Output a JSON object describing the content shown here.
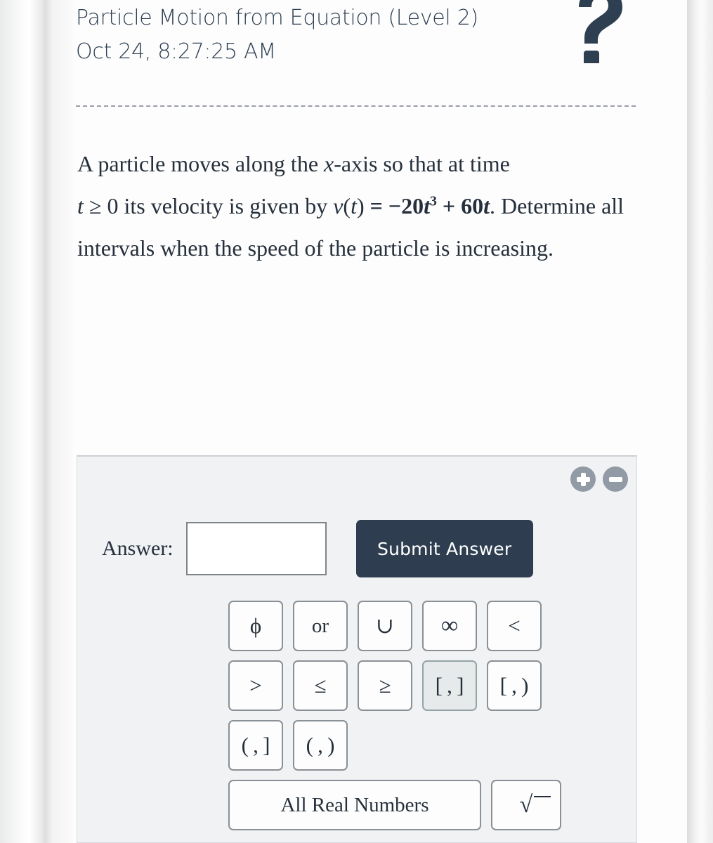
{
  "header": {
    "title": "Particle Motion from Equation (Level 2)",
    "timestamp": "Oct 24, 8:27:25 AM",
    "help_icon": "question-mark-icon"
  },
  "question": {
    "part1": "A particle moves along the ",
    "var_x": "x",
    "part2": "-axis so that at time ",
    "var_t": "t",
    "part3": " ≥ 0 its velocity is given by ",
    "equation_v": "v",
    "equation_open": "(",
    "equation_t": "t",
    "equation_close": ")",
    "equation_eq": " = −20",
    "equation_base": "t",
    "equation_exp": "3",
    "equation_plus": " + 60",
    "equation_tail": "t",
    "part4": ". Determine all intervals when the speed of the particle is increasing.",
    "full_text": "A particle moves along the x-axis so that at time t ≥ 0 its velocity is given by v(t) = −20t³ + 60t. Determine all intervals when the speed of the particle is increasing."
  },
  "answer_panel": {
    "label": "Answer:",
    "input_value": "",
    "input_placeholder": "",
    "submit_label": "Submit Answer",
    "zoom_in_label": "+",
    "zoom_out_label": "−",
    "zoom_in_icon": "plus-circle-icon",
    "zoom_out_icon": "minus-circle-icon"
  },
  "keypad": {
    "rows": [
      [
        {
          "label": "ϕ",
          "name": "empty-set",
          "selected": false
        },
        {
          "label": "or",
          "name": "or",
          "selected": false
        },
        {
          "label": "∪",
          "name": "union",
          "selected": false
        },
        {
          "label": "∞",
          "name": "infinity",
          "selected": false
        },
        {
          "label": "<",
          "name": "less-than",
          "selected": false
        }
      ],
      [
        {
          "label": ">",
          "name": "greater-than",
          "selected": false
        },
        {
          "label": "≤",
          "name": "less-than-or-equal",
          "selected": false
        },
        {
          "label": "≥",
          "name": "greater-than-or-equal",
          "selected": false
        },
        {
          "label": "[ , ]",
          "name": "closed-interval",
          "selected": true
        },
        {
          "label": "[ , )",
          "name": "half-open-interval-right",
          "selected": false
        }
      ],
      [
        {
          "label": "( , ]",
          "name": "half-open-interval-left",
          "selected": false
        },
        {
          "label": "( , )",
          "name": "open-interval",
          "selected": false
        }
      ],
      [
        {
          "label": "All Real Numbers",
          "name": "all-real-numbers",
          "selected": false
        },
        {
          "label": "√̅̅̅",
          "name": "square-root",
          "selected": false
        }
      ]
    ]
  },
  "colors": {
    "header_text": "#2e3f52",
    "body_text": "#26303c",
    "submit_bg": "#2e3e50",
    "submit_text": "#ffffff",
    "panel_bg": "#f0f2f4",
    "zoom_btn_bg": "#919aa5",
    "key_border": "#8b9096",
    "key_selected_bg": "#e7eaeb",
    "divider": "#9aa0a6",
    "page_bg": "#fdfdfd"
  }
}
